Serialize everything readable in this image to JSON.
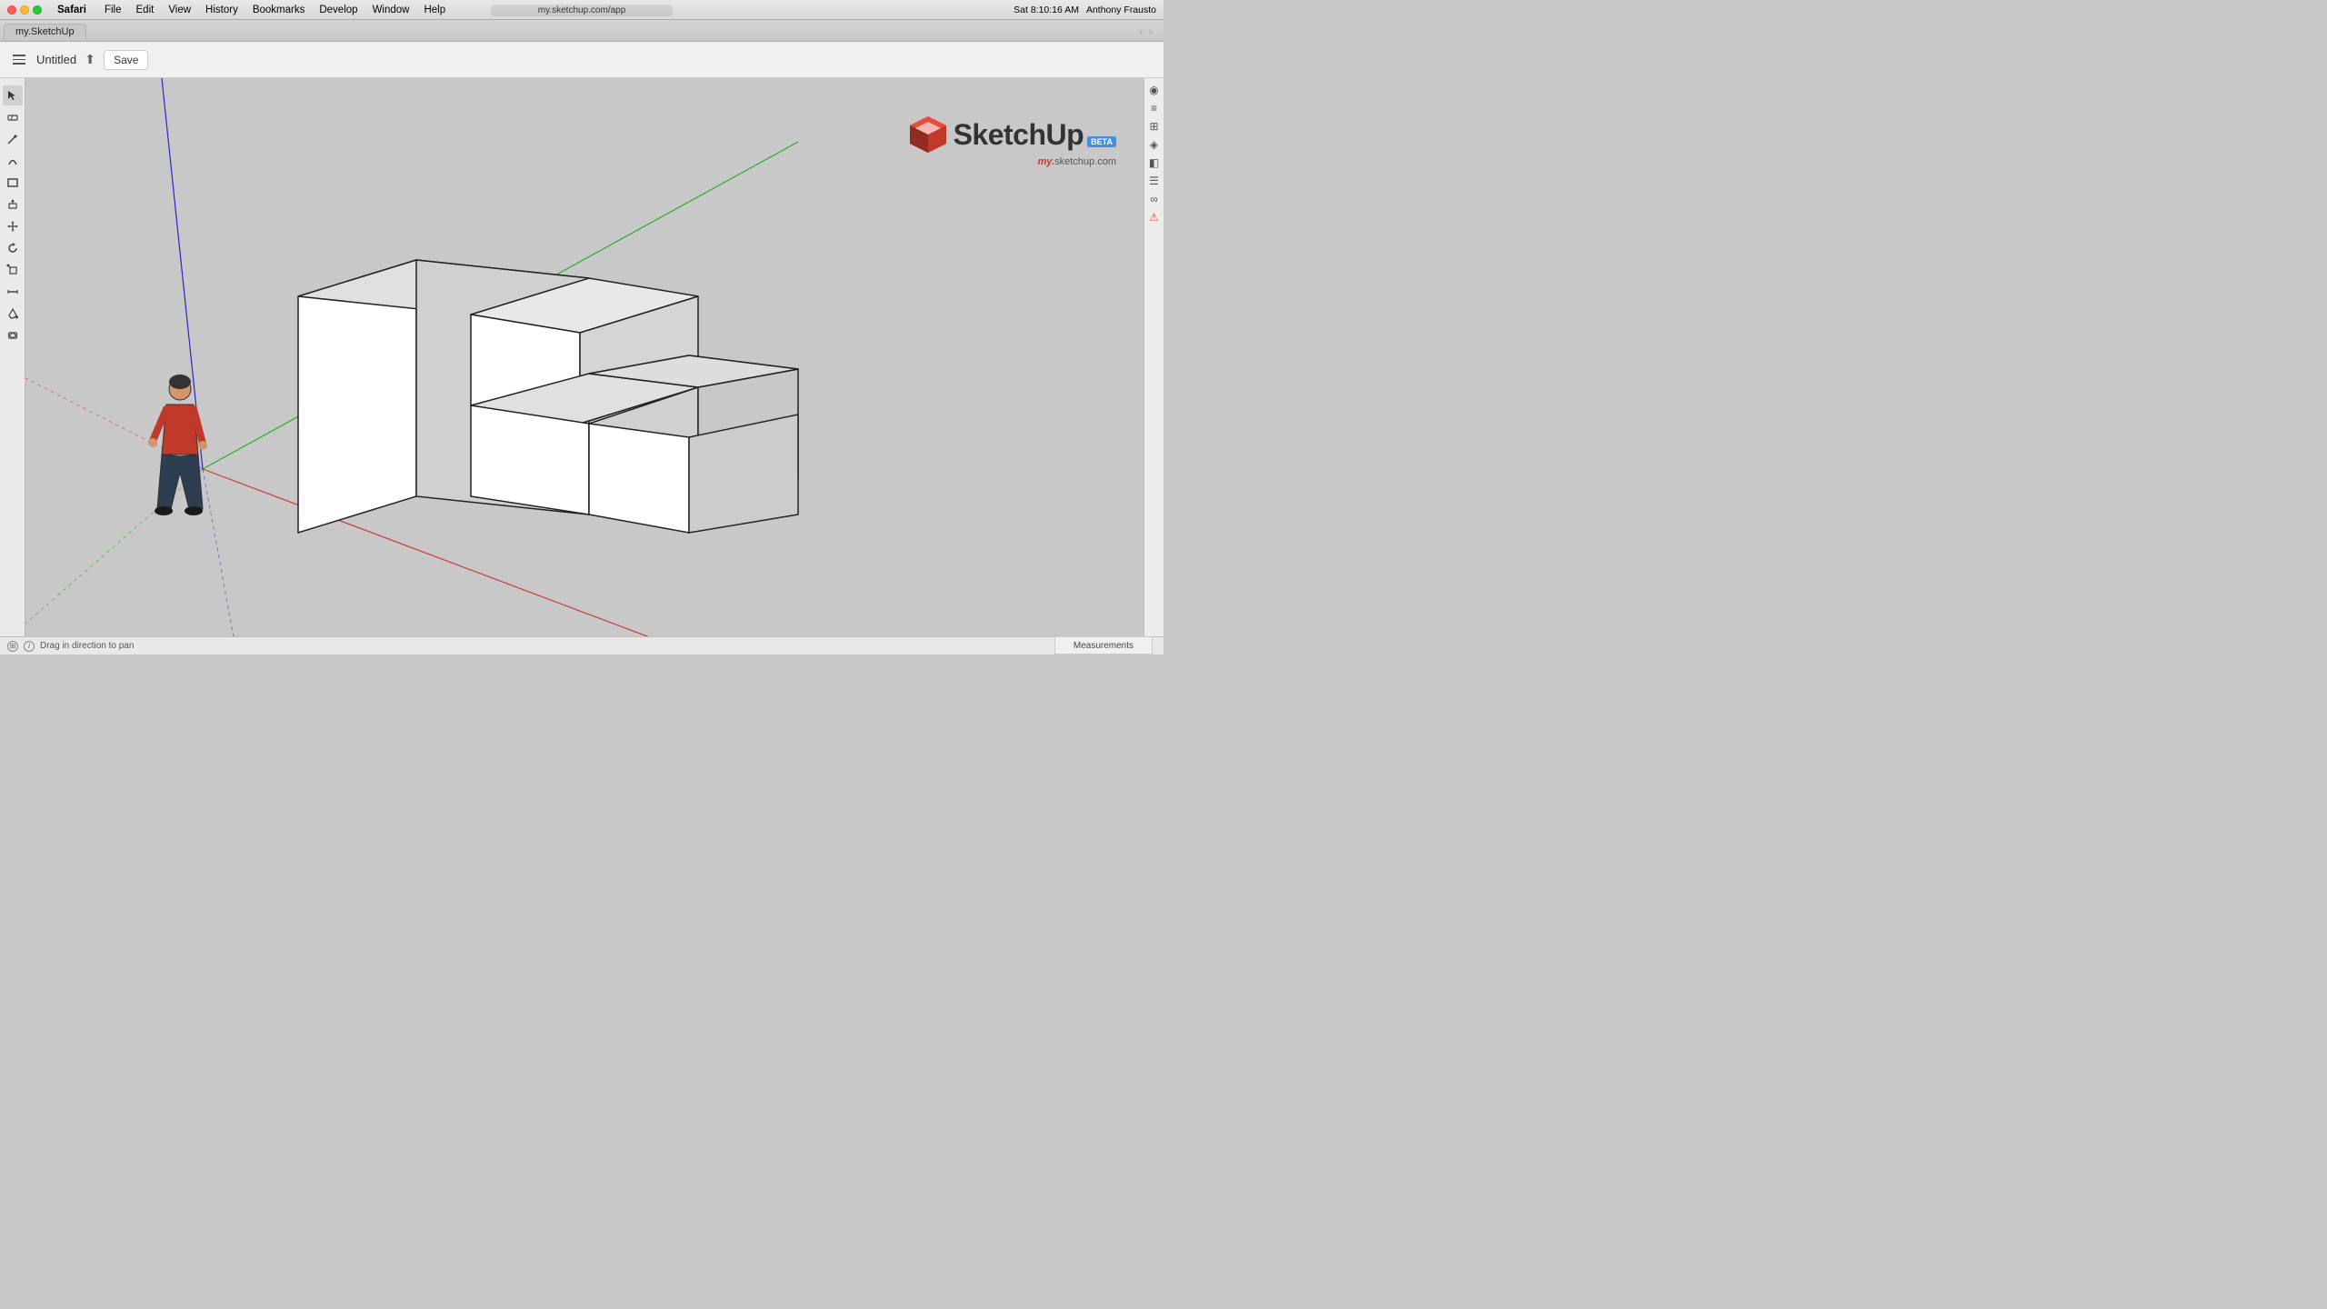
{
  "menubar": {
    "app_name": "Safari",
    "menus": [
      "Safari",
      "File",
      "Edit",
      "View",
      "History",
      "Bookmarks",
      "Develop",
      "Window",
      "Help"
    ],
    "url": "my.sketchup.com/app",
    "tab_title": "my.SketchUp",
    "time": "Sat 8:10:16 AM",
    "user": "Anthony Frausto"
  },
  "toolbar": {
    "title": "Untitled",
    "save_label": "Save",
    "share_icon": "⬆"
  },
  "logo": {
    "text": "SketchUp",
    "beta": "BETA",
    "url": "my.sketchup.com",
    "url_prefix": "my."
  },
  "left_tools": [
    {
      "name": "select",
      "icon": "↖",
      "label": "Select"
    },
    {
      "name": "eraser",
      "icon": "⌫",
      "label": "Eraser"
    },
    {
      "name": "pencil",
      "icon": "✏",
      "label": "Draw"
    },
    {
      "name": "arc",
      "icon": "⌒",
      "label": "Arc"
    },
    {
      "name": "rectangle",
      "icon": "▭",
      "label": "Rectangle"
    },
    {
      "name": "push-pull",
      "icon": "⬤",
      "label": "Push/Pull"
    },
    {
      "name": "move",
      "icon": "✛",
      "label": "Move"
    },
    {
      "name": "rotate",
      "icon": "↻",
      "label": "Rotate"
    },
    {
      "name": "scale",
      "icon": "⤡",
      "label": "Scale"
    },
    {
      "name": "tape",
      "icon": "⊸",
      "label": "Tape Measure"
    },
    {
      "name": "paint",
      "icon": "🪣",
      "label": "Paint Bucket"
    },
    {
      "name": "orbit",
      "icon": "⟳",
      "label": "Orbit"
    }
  ],
  "right_tools": [
    {
      "name": "eye",
      "icon": "👁",
      "label": "Camera"
    },
    {
      "name": "layers",
      "icon": "≡",
      "label": "Layers"
    },
    {
      "name": "components",
      "icon": "⊞",
      "label": "Components"
    },
    {
      "name": "styles",
      "icon": "◈",
      "label": "Styles"
    },
    {
      "name": "scenes",
      "icon": "◧",
      "label": "Scenes"
    },
    {
      "name": "outliner",
      "icon": "☰",
      "label": "Outliner"
    },
    {
      "name": "entity",
      "icon": "∞",
      "label": "Entity Info"
    },
    {
      "name": "warning",
      "icon": "⚠",
      "label": "Warnings"
    }
  ],
  "statusbar": {
    "hint_icon": "i",
    "hint_text": "Drag in direction to pan",
    "measurements_label": "Measurements",
    "nav_icon": "⊞"
  },
  "viewport": {
    "bg_color": "#c8c8c8",
    "axis_colors": {
      "x": "#cc0000",
      "y": "#00aa00",
      "z": "#0000cc",
      "x_neg": "#cc000066",
      "y_neg": "#00aa0066",
      "z_neg": "#0000cc66"
    }
  }
}
